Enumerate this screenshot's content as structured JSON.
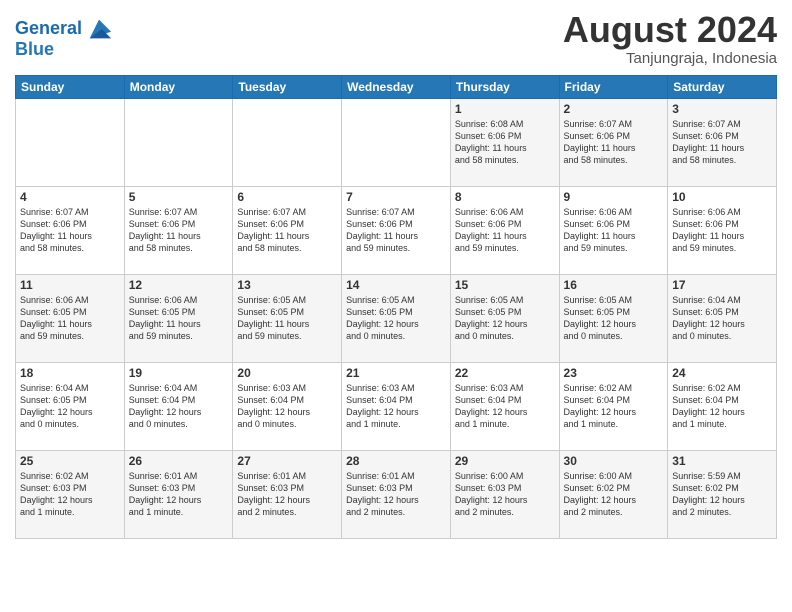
{
  "header": {
    "logo_line1": "General",
    "logo_line2": "Blue",
    "month_year": "August 2024",
    "location": "Tanjungraja, Indonesia"
  },
  "weekdays": [
    "Sunday",
    "Monday",
    "Tuesday",
    "Wednesday",
    "Thursday",
    "Friday",
    "Saturday"
  ],
  "weeks": [
    [
      {
        "day": "",
        "info": ""
      },
      {
        "day": "",
        "info": ""
      },
      {
        "day": "",
        "info": ""
      },
      {
        "day": "",
        "info": ""
      },
      {
        "day": "1",
        "info": "Sunrise: 6:08 AM\nSunset: 6:06 PM\nDaylight: 11 hours\nand 58 minutes."
      },
      {
        "day": "2",
        "info": "Sunrise: 6:07 AM\nSunset: 6:06 PM\nDaylight: 11 hours\nand 58 minutes."
      },
      {
        "day": "3",
        "info": "Sunrise: 6:07 AM\nSunset: 6:06 PM\nDaylight: 11 hours\nand 58 minutes."
      }
    ],
    [
      {
        "day": "4",
        "info": "Sunrise: 6:07 AM\nSunset: 6:06 PM\nDaylight: 11 hours\nand 58 minutes."
      },
      {
        "day": "5",
        "info": "Sunrise: 6:07 AM\nSunset: 6:06 PM\nDaylight: 11 hours\nand 58 minutes."
      },
      {
        "day": "6",
        "info": "Sunrise: 6:07 AM\nSunset: 6:06 PM\nDaylight: 11 hours\nand 58 minutes."
      },
      {
        "day": "7",
        "info": "Sunrise: 6:07 AM\nSunset: 6:06 PM\nDaylight: 11 hours\nand 59 minutes."
      },
      {
        "day": "8",
        "info": "Sunrise: 6:06 AM\nSunset: 6:06 PM\nDaylight: 11 hours\nand 59 minutes."
      },
      {
        "day": "9",
        "info": "Sunrise: 6:06 AM\nSunset: 6:06 PM\nDaylight: 11 hours\nand 59 minutes."
      },
      {
        "day": "10",
        "info": "Sunrise: 6:06 AM\nSunset: 6:06 PM\nDaylight: 11 hours\nand 59 minutes."
      }
    ],
    [
      {
        "day": "11",
        "info": "Sunrise: 6:06 AM\nSunset: 6:05 PM\nDaylight: 11 hours\nand 59 minutes."
      },
      {
        "day": "12",
        "info": "Sunrise: 6:06 AM\nSunset: 6:05 PM\nDaylight: 11 hours\nand 59 minutes."
      },
      {
        "day": "13",
        "info": "Sunrise: 6:05 AM\nSunset: 6:05 PM\nDaylight: 11 hours\nand 59 minutes."
      },
      {
        "day": "14",
        "info": "Sunrise: 6:05 AM\nSunset: 6:05 PM\nDaylight: 12 hours\nand 0 minutes."
      },
      {
        "day": "15",
        "info": "Sunrise: 6:05 AM\nSunset: 6:05 PM\nDaylight: 12 hours\nand 0 minutes."
      },
      {
        "day": "16",
        "info": "Sunrise: 6:05 AM\nSunset: 6:05 PM\nDaylight: 12 hours\nand 0 minutes."
      },
      {
        "day": "17",
        "info": "Sunrise: 6:04 AM\nSunset: 6:05 PM\nDaylight: 12 hours\nand 0 minutes."
      }
    ],
    [
      {
        "day": "18",
        "info": "Sunrise: 6:04 AM\nSunset: 6:05 PM\nDaylight: 12 hours\nand 0 minutes."
      },
      {
        "day": "19",
        "info": "Sunrise: 6:04 AM\nSunset: 6:04 PM\nDaylight: 12 hours\nand 0 minutes."
      },
      {
        "day": "20",
        "info": "Sunrise: 6:03 AM\nSunset: 6:04 PM\nDaylight: 12 hours\nand 0 minutes."
      },
      {
        "day": "21",
        "info": "Sunrise: 6:03 AM\nSunset: 6:04 PM\nDaylight: 12 hours\nand 1 minute."
      },
      {
        "day": "22",
        "info": "Sunrise: 6:03 AM\nSunset: 6:04 PM\nDaylight: 12 hours\nand 1 minute."
      },
      {
        "day": "23",
        "info": "Sunrise: 6:02 AM\nSunset: 6:04 PM\nDaylight: 12 hours\nand 1 minute."
      },
      {
        "day": "24",
        "info": "Sunrise: 6:02 AM\nSunset: 6:04 PM\nDaylight: 12 hours\nand 1 minute."
      }
    ],
    [
      {
        "day": "25",
        "info": "Sunrise: 6:02 AM\nSunset: 6:03 PM\nDaylight: 12 hours\nand 1 minute."
      },
      {
        "day": "26",
        "info": "Sunrise: 6:01 AM\nSunset: 6:03 PM\nDaylight: 12 hours\nand 1 minute."
      },
      {
        "day": "27",
        "info": "Sunrise: 6:01 AM\nSunset: 6:03 PM\nDaylight: 12 hours\nand 2 minutes."
      },
      {
        "day": "28",
        "info": "Sunrise: 6:01 AM\nSunset: 6:03 PM\nDaylight: 12 hours\nand 2 minutes."
      },
      {
        "day": "29",
        "info": "Sunrise: 6:00 AM\nSunset: 6:03 PM\nDaylight: 12 hours\nand 2 minutes."
      },
      {
        "day": "30",
        "info": "Sunrise: 6:00 AM\nSunset: 6:02 PM\nDaylight: 12 hours\nand 2 minutes."
      },
      {
        "day": "31",
        "info": "Sunrise: 5:59 AM\nSunset: 6:02 PM\nDaylight: 12 hours\nand 2 minutes."
      }
    ]
  ]
}
